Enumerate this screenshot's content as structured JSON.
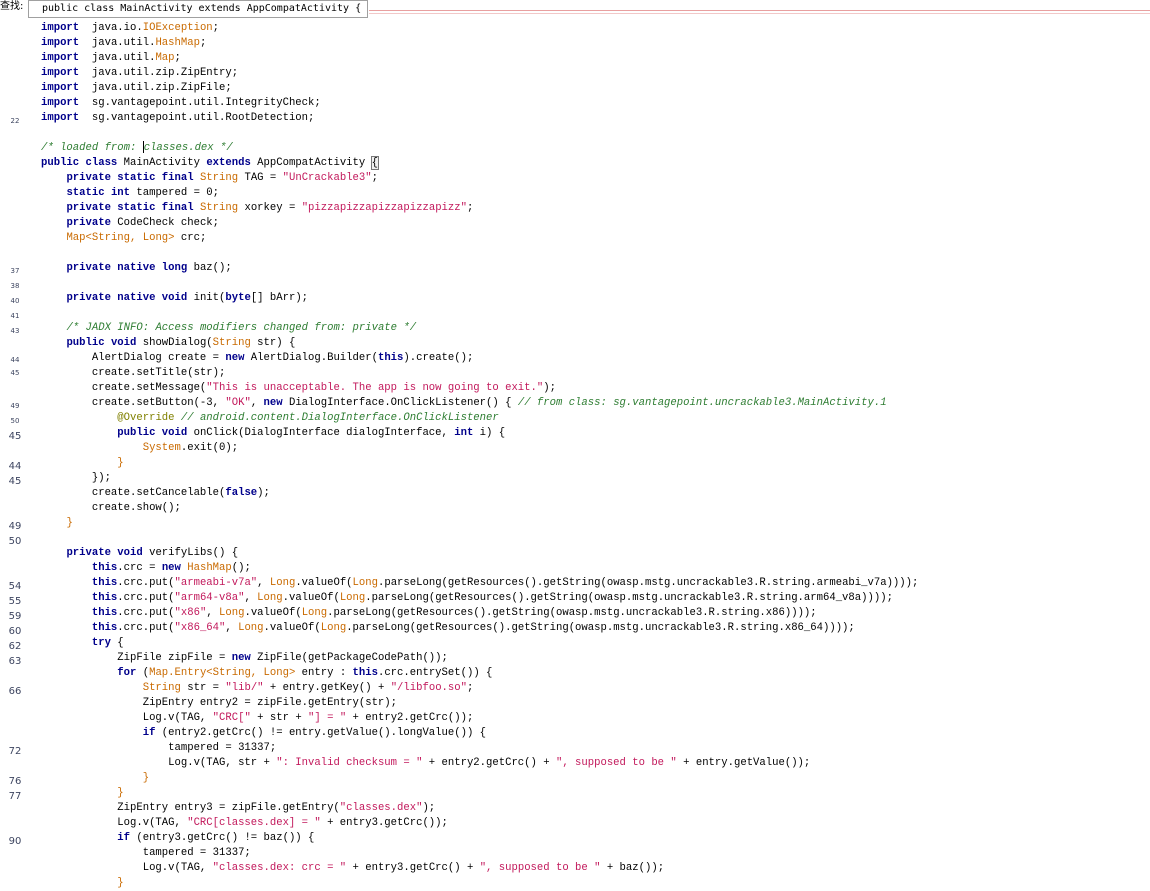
{
  "find_bar": {
    "label": "查找:",
    "value": "public class MainActivity extends AppCompatActivity {"
  },
  "gutter_numbers": [
    {
      "row": 7,
      "text": "22",
      "size": "small"
    },
    {
      "row": 17,
      "text": "37",
      "size": "small"
    },
    {
      "row": 18,
      "text": "38",
      "size": "small"
    },
    {
      "row": 19,
      "text": "40",
      "size": "small"
    },
    {
      "row": 20,
      "text": "41",
      "size": "small"
    },
    {
      "row": 21,
      "text": "43",
      "size": "small"
    },
    {
      "row": 22.9,
      "text": "44",
      "size": "small"
    },
    {
      "row": 23.8,
      "text": "45",
      "size": "small"
    },
    {
      "row": 26,
      "text": "49",
      "size": "small"
    },
    {
      "row": 27,
      "text": "50",
      "size": "small"
    },
    {
      "row": 28,
      "text": "45",
      "size": "big"
    },
    {
      "row": 30,
      "text": "44",
      "size": "big"
    },
    {
      "row": 31,
      "text": "45",
      "size": "big"
    },
    {
      "row": 34,
      "text": "49",
      "size": "big"
    },
    {
      "row": 35,
      "text": "50",
      "size": "big"
    },
    {
      "row": 38,
      "text": "54",
      "size": "big"
    },
    {
      "row": 39,
      "text": "55",
      "size": "big"
    },
    {
      "row": 40,
      "text": "59",
      "size": "big"
    },
    {
      "row": 41,
      "text": "60",
      "size": "big"
    },
    {
      "row": 42,
      "text": "62",
      "size": "big"
    },
    {
      "row": 43,
      "text": "63",
      "size": "big"
    },
    {
      "row": 45,
      "text": "66",
      "size": "big"
    },
    {
      "row": 49,
      "text": "72",
      "size": "big"
    },
    {
      "row": 51,
      "text": "76",
      "size": "big"
    },
    {
      "row": 52,
      "text": "77",
      "size": "big"
    },
    {
      "row": 55,
      "text": "90",
      "size": "big"
    }
  ],
  "code_lines": [
    [
      [
        "kw",
        "import"
      ],
      [
        "",
        "  java.io."
      ],
      [
        "ty",
        "IOException"
      ],
      [
        "",
        ";"
      ]
    ],
    [
      [
        "kw",
        "import"
      ],
      [
        "",
        "  java.util."
      ],
      [
        "ty",
        "HashMap"
      ],
      [
        "",
        ";"
      ]
    ],
    [
      [
        "kw",
        "import"
      ],
      [
        "",
        "  java.util."
      ],
      [
        "ty",
        "Map"
      ],
      [
        "",
        ";"
      ]
    ],
    [
      [
        "kw",
        "import"
      ],
      [
        "",
        "  java.util.zip.ZipEntry;"
      ]
    ],
    [
      [
        "kw",
        "import"
      ],
      [
        "",
        "  java.util.zip.ZipFile;"
      ]
    ],
    [
      [
        "kw",
        "import"
      ],
      [
        "",
        "  sg.vantagepoint.util.IntegrityCheck;"
      ]
    ],
    [
      [
        "kw",
        "import"
      ],
      [
        "",
        "  sg.vantagepoint.util.RootDetection;"
      ]
    ],
    [],
    [
      [
        "cm",
        "/* loaded from: "
      ],
      [
        "cursor",
        ""
      ],
      [
        "cm",
        "classes.dex */"
      ]
    ],
    [
      [
        "kw",
        "public class"
      ],
      [
        "",
        " MainActivity "
      ],
      [
        "kw",
        "extends"
      ],
      [
        "",
        " AppCompatActivity "
      ],
      [
        "bracket",
        "{"
      ]
    ],
    [
      [
        "",
        "    "
      ],
      [
        "kw",
        "private static final"
      ],
      [
        "",
        " "
      ],
      [
        "ty",
        "String"
      ],
      [
        "",
        " TAG = "
      ],
      [
        "str",
        "\"UnCrackable3\""
      ],
      [
        "",
        ";"
      ]
    ],
    [
      [
        "",
        "    "
      ],
      [
        "kw",
        "static int"
      ],
      [
        "",
        " tampered = 0;"
      ]
    ],
    [
      [
        "",
        "    "
      ],
      [
        "kw",
        "private static final"
      ],
      [
        "",
        " "
      ],
      [
        "ty",
        "String"
      ],
      [
        "",
        " xorkey = "
      ],
      [
        "str",
        "\"pizzapizzapizzapizzapizz\""
      ],
      [
        "",
        ";"
      ]
    ],
    [
      [
        "",
        "    "
      ],
      [
        "kw",
        "private"
      ],
      [
        "",
        " CodeCheck check;"
      ]
    ],
    [
      [
        "",
        "    "
      ],
      [
        "ty",
        "Map<String, Long>"
      ],
      [
        "",
        " crc;"
      ]
    ],
    [],
    [
      [
        "",
        "    "
      ],
      [
        "kw",
        "private native long"
      ],
      [
        "",
        " baz();"
      ]
    ],
    [],
    [
      [
        "",
        "    "
      ],
      [
        "kw",
        "private native void"
      ],
      [
        "",
        " init("
      ],
      [
        "kw",
        "byte"
      ],
      [
        "",
        "[] bArr);"
      ]
    ],
    [],
    [
      [
        "",
        "    "
      ],
      [
        "cm",
        "/* JADX INFO: Access modifiers changed from: private */"
      ]
    ],
    [
      [
        "",
        "    "
      ],
      [
        "kw",
        "public void"
      ],
      [
        "",
        " showDialog("
      ],
      [
        "ty",
        "String"
      ],
      [
        "",
        " str) {"
      ]
    ],
    [
      [
        "",
        "        AlertDialog create = "
      ],
      [
        "kw",
        "new"
      ],
      [
        "",
        " AlertDialog.Builder("
      ],
      [
        "kw",
        "this"
      ],
      [
        "",
        ").create();"
      ]
    ],
    [
      [
        "",
        "        create.setTitle(str);"
      ]
    ],
    [
      [
        "",
        "        create.setMessage("
      ],
      [
        "str",
        "\"This is unacceptable. The app is now going to exit.\""
      ],
      [
        "",
        ");"
      ]
    ],
    [
      [
        "",
        "        create.setButton(-3, "
      ],
      [
        "str",
        "\"OK\""
      ],
      [
        "",
        ", "
      ],
      [
        "kw",
        "new"
      ],
      [
        "",
        " DialogInterface.OnClickListener() { "
      ],
      [
        "cm",
        "// from class: sg.vantagepoint.uncrackable3.MainActivity.1"
      ]
    ],
    [
      [
        "",
        "            "
      ],
      [
        "an",
        "@Override"
      ],
      [
        "",
        " "
      ],
      [
        "cm",
        "// android.content.DialogInterface.OnClickListener"
      ]
    ],
    [
      [
        "",
        "            "
      ],
      [
        "kw",
        "public void"
      ],
      [
        "",
        " onClick(DialogInterface dialogInterface, "
      ],
      [
        "kw",
        "int"
      ],
      [
        "",
        " i) {"
      ]
    ],
    [
      [
        "",
        "                "
      ],
      [
        "ty",
        "System"
      ],
      [
        "",
        ".exit(0);"
      ]
    ],
    [
      [
        "",
        "            "
      ],
      [
        "sp",
        "}"
      ]
    ],
    [
      [
        "",
        "        });"
      ]
    ],
    [
      [
        "",
        "        create.setCancelable("
      ],
      [
        "kw",
        "false"
      ],
      [
        "",
        ");"
      ]
    ],
    [
      [
        "",
        "        create.show();"
      ]
    ],
    [
      [
        "",
        "    "
      ],
      [
        "sp",
        "}"
      ]
    ],
    [],
    [
      [
        "",
        "    "
      ],
      [
        "kw",
        "private void"
      ],
      [
        "",
        " verifyLibs() {"
      ]
    ],
    [
      [
        "",
        "        "
      ],
      [
        "kw",
        "this"
      ],
      [
        "",
        ".crc = "
      ],
      [
        "kw",
        "new"
      ],
      [
        "",
        " "
      ],
      [
        "ty",
        "HashMap"
      ],
      [
        "",
        "();"
      ]
    ],
    [
      [
        "",
        "        "
      ],
      [
        "kw",
        "this"
      ],
      [
        "",
        ".crc.put("
      ],
      [
        "str",
        "\"armeabi-v7a\""
      ],
      [
        "",
        ", "
      ],
      [
        "ty",
        "Long"
      ],
      [
        "",
        ".valueOf("
      ],
      [
        "ty",
        "Long"
      ],
      [
        "",
        ".parseLong(getResources().getString(owasp.mstg.uncrackable3.R.string.armeabi_v7a))));"
      ]
    ],
    [
      [
        "",
        "        "
      ],
      [
        "kw",
        "this"
      ],
      [
        "",
        ".crc.put("
      ],
      [
        "str",
        "\"arm64-v8a\""
      ],
      [
        "",
        ", "
      ],
      [
        "ty",
        "Long"
      ],
      [
        "",
        ".valueOf("
      ],
      [
        "ty",
        "Long"
      ],
      [
        "",
        ".parseLong(getResources().getString(owasp.mstg.uncrackable3.R.string.arm64_v8a))));"
      ]
    ],
    [
      [
        "",
        "        "
      ],
      [
        "kw",
        "this"
      ],
      [
        "",
        ".crc.put("
      ],
      [
        "str",
        "\"x86\""
      ],
      [
        "",
        ", "
      ],
      [
        "ty",
        "Long"
      ],
      [
        "",
        ".valueOf("
      ],
      [
        "ty",
        "Long"
      ],
      [
        "",
        ".parseLong(getResources().getString(owasp.mstg.uncrackable3.R.string.x86))));"
      ]
    ],
    [
      [
        "",
        "        "
      ],
      [
        "kw",
        "this"
      ],
      [
        "",
        ".crc.put("
      ],
      [
        "str",
        "\"x86_64\""
      ],
      [
        "",
        ", "
      ],
      [
        "ty",
        "Long"
      ],
      [
        "",
        ".valueOf("
      ],
      [
        "ty",
        "Long"
      ],
      [
        "",
        ".parseLong(getResources().getString(owasp.mstg.uncrackable3.R.string.x86_64))));"
      ]
    ],
    [
      [
        "",
        "        "
      ],
      [
        "kw",
        "try"
      ],
      [
        "",
        " {"
      ]
    ],
    [
      [
        "",
        "            ZipFile zipFile = "
      ],
      [
        "kw",
        "new"
      ],
      [
        "",
        " ZipFile(getPackageCodePath());"
      ]
    ],
    [
      [
        "",
        "            "
      ],
      [
        "kw",
        "for"
      ],
      [
        "",
        " ("
      ],
      [
        "ty",
        "Map.Entry<String, Long>"
      ],
      [
        "",
        " entry : "
      ],
      [
        "kw",
        "this"
      ],
      [
        "",
        ".crc.entrySet()) {"
      ]
    ],
    [
      [
        "",
        "                "
      ],
      [
        "ty",
        "String"
      ],
      [
        "",
        " str = "
      ],
      [
        "str",
        "\"lib/\""
      ],
      [
        "",
        " + entry.getKey() + "
      ],
      [
        "str",
        "\"/libfoo.so\""
      ],
      [
        "",
        ";"
      ]
    ],
    [
      [
        "",
        "                ZipEntry entry2 = zipFile.getEntry(str);"
      ]
    ],
    [
      [
        "",
        "                Log.v(TAG, "
      ],
      [
        "str",
        "\"CRC[\""
      ],
      [
        "",
        " + str + "
      ],
      [
        "str",
        "\"] = \""
      ],
      [
        "",
        " + entry2.getCrc());"
      ]
    ],
    [
      [
        "",
        "                "
      ],
      [
        "kw",
        "if"
      ],
      [
        "",
        " (entry2.getCrc() != entry.getValue().longValue()) {"
      ]
    ],
    [
      [
        "",
        "                    tampered = 31337;"
      ]
    ],
    [
      [
        "",
        "                    Log.v(TAG, str + "
      ],
      [
        "str",
        "\": Invalid checksum = \""
      ],
      [
        "",
        " + entry2.getCrc() + "
      ],
      [
        "str",
        "\", supposed to be \""
      ],
      [
        "",
        " + entry.getValue());"
      ]
    ],
    [
      [
        "",
        "                "
      ],
      [
        "sp",
        "}"
      ]
    ],
    [
      [
        "",
        "            "
      ],
      [
        "sp",
        "}"
      ]
    ],
    [
      [
        "",
        "            ZipEntry entry3 = zipFile.getEntry("
      ],
      [
        "str",
        "\"classes.dex\""
      ],
      [
        "",
        ");"
      ]
    ],
    [
      [
        "",
        "            Log.v(TAG, "
      ],
      [
        "str",
        "\"CRC[classes.dex] = \""
      ],
      [
        "",
        " + entry3.getCrc());"
      ]
    ],
    [
      [
        "",
        "            "
      ],
      [
        "kw",
        "if"
      ],
      [
        "",
        " (entry3.getCrc() != baz()) {"
      ]
    ],
    [
      [
        "",
        "                tampered = 31337;"
      ]
    ],
    [
      [
        "",
        "                Log.v(TAG, "
      ],
      [
        "str",
        "\"classes.dex: crc = \""
      ],
      [
        "",
        " + entry3.getCrc() + "
      ],
      [
        "str",
        "\", supposed to be \""
      ],
      [
        "",
        " + baz());"
      ]
    ],
    [
      [
        "",
        "            "
      ],
      [
        "sp",
        "}"
      ]
    ]
  ]
}
